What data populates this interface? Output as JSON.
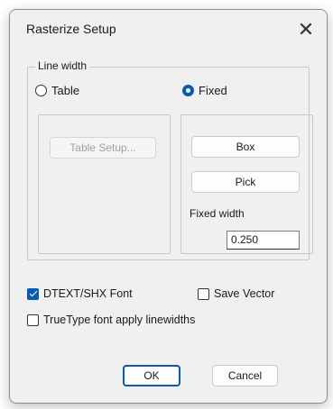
{
  "window": {
    "title": "Rasterize Setup",
    "close_glyph": "✕"
  },
  "line_width": {
    "legend": "Line width",
    "table_radio": {
      "label": "Table",
      "selected": false
    },
    "fixed_radio": {
      "label": "Fixed",
      "selected": true
    },
    "table_setup_label": "Table Setup...",
    "box_label": "Box",
    "pick_label": "Pick",
    "fixed_width_label": "Fixed width",
    "fixed_width_value": "0.250"
  },
  "options": {
    "dtext_shx": {
      "label": "DTEXT/SHX Font",
      "checked": true
    },
    "save_vector": {
      "label": "Save Vector",
      "checked": false
    },
    "truetype_linewidths": {
      "label": "TrueType font apply linewidths",
      "checked": false
    }
  },
  "footer": {
    "ok_label": "OK",
    "cancel_label": "Cancel"
  },
  "colors": {
    "accent": "#0b5cad",
    "dialog_bg": "#f0f0f0"
  }
}
